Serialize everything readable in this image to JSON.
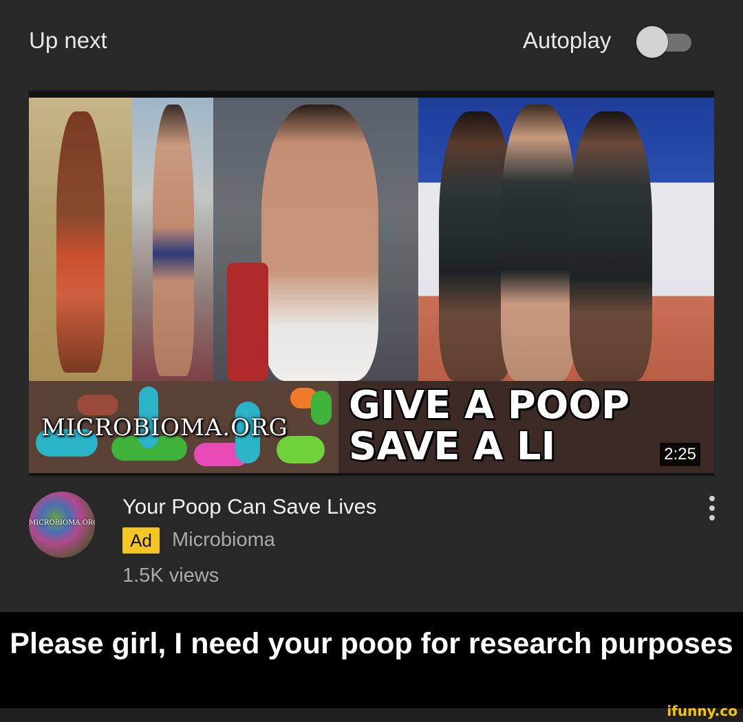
{
  "header": {
    "up_next_label": "Up next",
    "autoplay_label": "Autoplay",
    "autoplay_on": false
  },
  "video": {
    "thumbnail": {
      "logo_text": "MICROBIOMA.ORG",
      "slogan_line1": "GIVE A POOP",
      "slogan_line2": "SAVE A LI",
      "duration": "2:25"
    },
    "title": "Your Poop Can Save Lives",
    "ad_badge": "Ad",
    "channel": "Microbioma",
    "views": "1.5K views",
    "avatar_text": "MICROBIOMA.ORG"
  },
  "caption": {
    "text": "Please girl, I need your poop for research purposes"
  },
  "watermark": "ifunny.co",
  "colors": {
    "background": "#282828",
    "ad_badge": "#f3c623",
    "caption_bg": "#000000",
    "watermark": "#f7c600"
  }
}
